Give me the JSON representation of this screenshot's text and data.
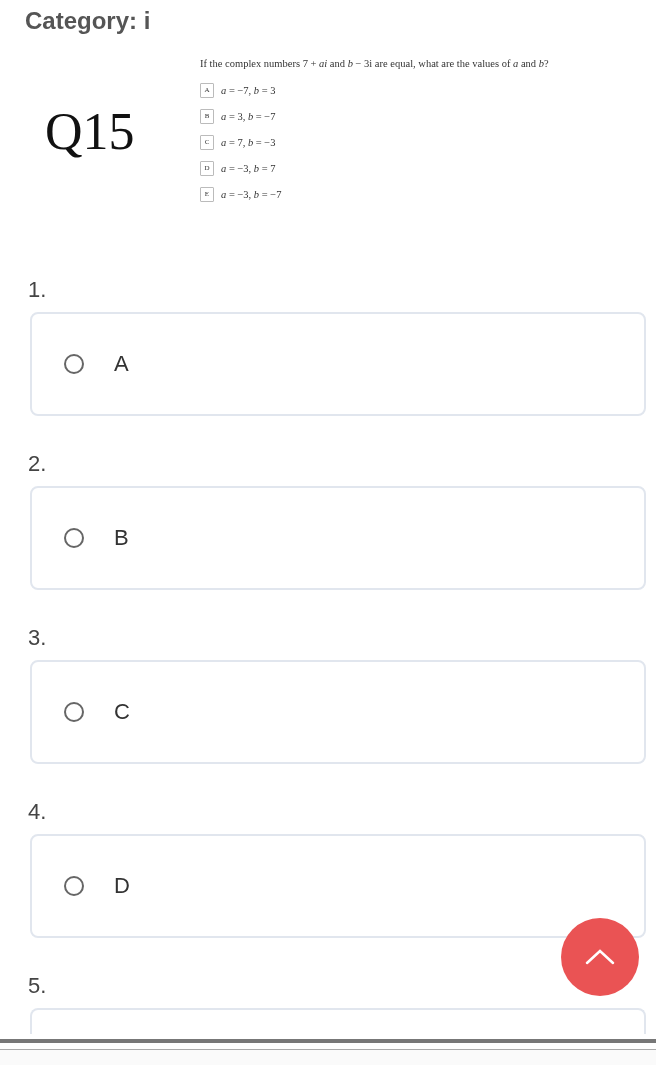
{
  "title": "Category: i",
  "question": {
    "number": "Q15",
    "text": "If the complex numbers 7 + *ai* and *b* − 3i are equal, what are the values of *a* and *b*?",
    "choices": [
      {
        "letter": "A",
        "text": "*a* = −7, *b* = 3"
      },
      {
        "letter": "B",
        "text": "*a* = 3, *b* = −7"
      },
      {
        "letter": "C",
        "text": "*a* = 7, *b* = −3"
      },
      {
        "letter": "D",
        "text": "*a* = −3, *b* = 7"
      },
      {
        "letter": "E",
        "text": "*a* = −3, *b* = −7"
      }
    ]
  },
  "answers": [
    {
      "number": "1.",
      "option": "A",
      "selected": false
    },
    {
      "number": "2.",
      "option": "B",
      "selected": false
    },
    {
      "number": "3.",
      "option": "C",
      "selected": false
    },
    {
      "number": "4.",
      "option": "D",
      "selected": false
    },
    {
      "number": "5."
    }
  ]
}
